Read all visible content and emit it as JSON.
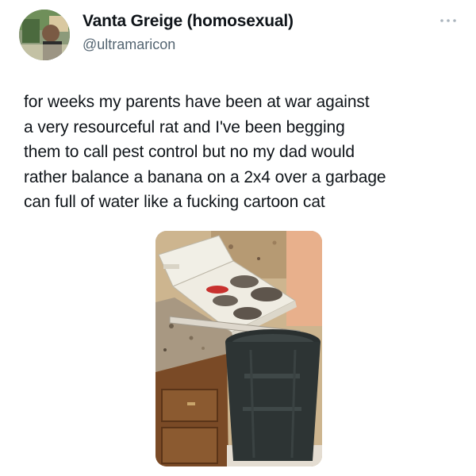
{
  "tweet": {
    "author": {
      "display_name": "Vanta Greige (homosexual)",
      "handle": "@ultramaricon",
      "avatar_icon": "profile-avatar"
    },
    "more_icon": "more-horizontal-icon",
    "text_lines": [
      "for weeks my parents have been at war against",
      "a very resourceful rat and I've been begging",
      "them to call pest control but no my dad would",
      "rather balance a banana on a 2x4 over a garbage",
      "can full of water like a fucking cartoon cat"
    ],
    "media": {
      "kind": "photo",
      "subject": "kitchen-stove-banana-board-trash-can"
    }
  },
  "colors": {
    "text": "#0f1419",
    "secondary_text": "#536471",
    "background": "#ffffff"
  }
}
